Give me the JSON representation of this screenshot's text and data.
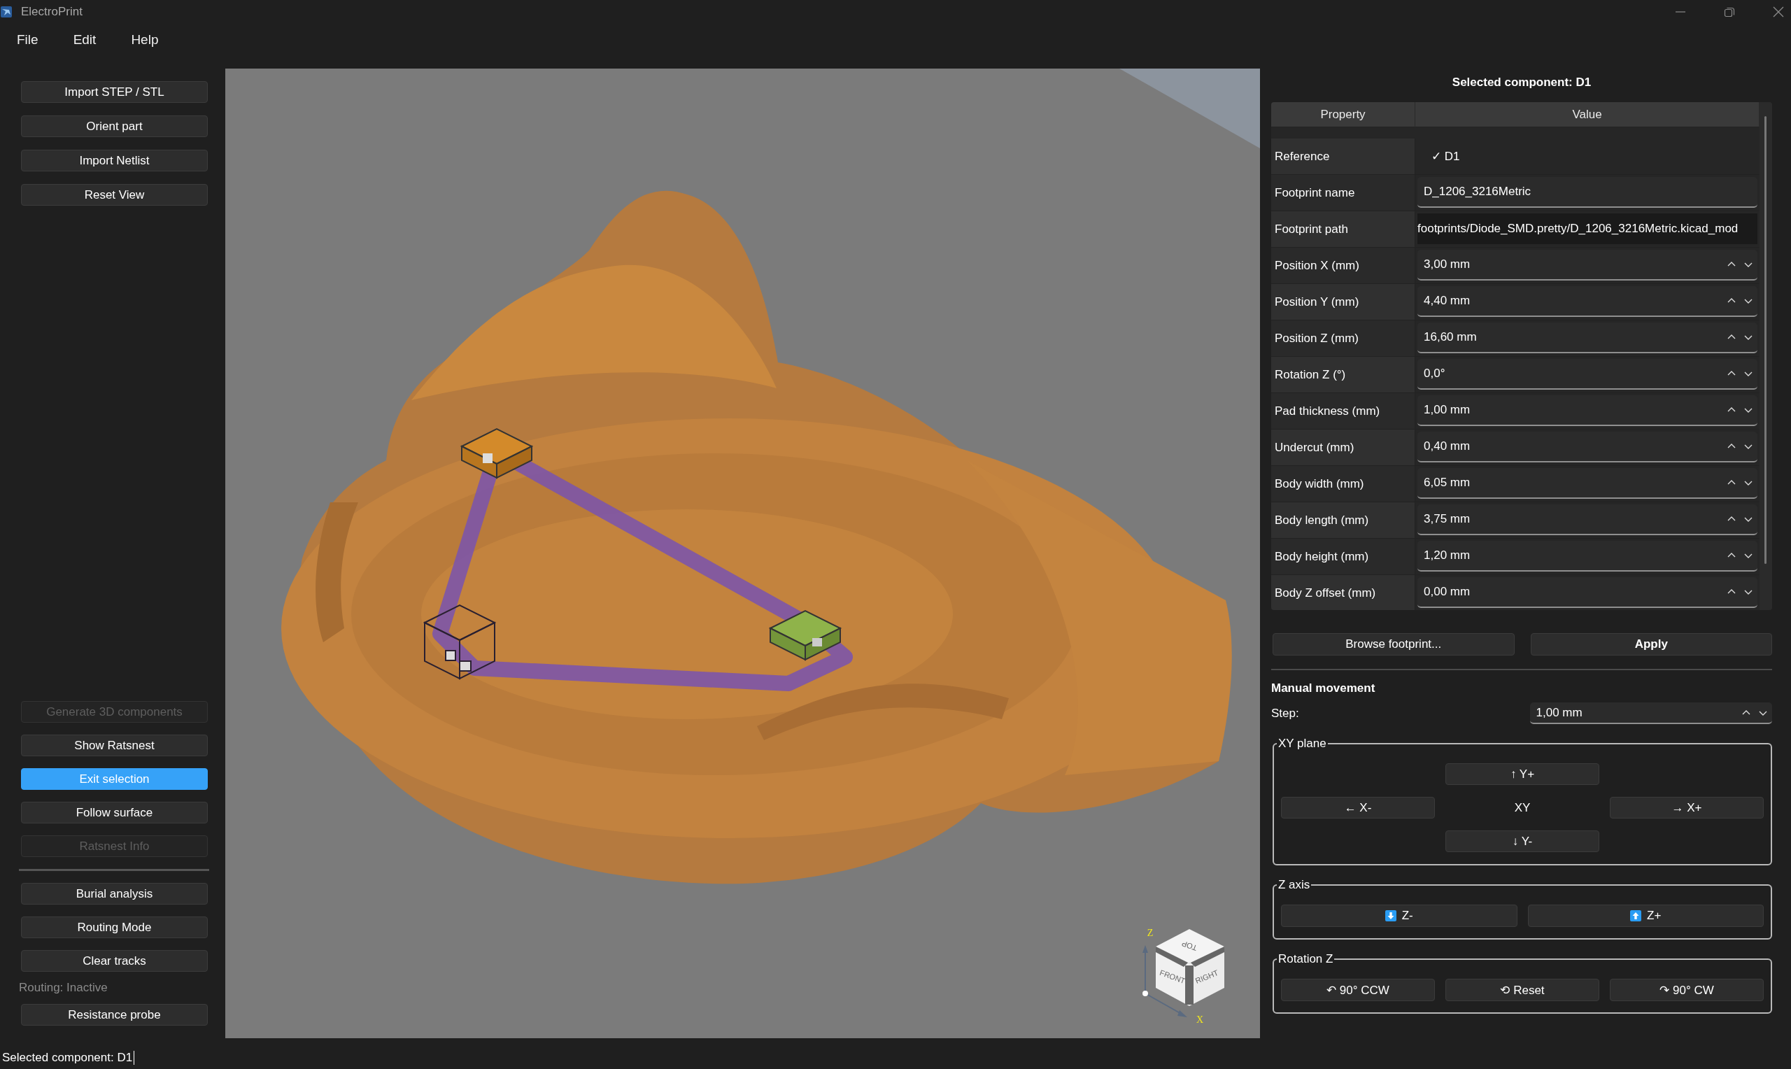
{
  "window": {
    "title": "ElectroPrint"
  },
  "menu": [
    {
      "label": "File"
    },
    {
      "label": "Edit"
    },
    {
      "label": "Help"
    }
  ],
  "sidebar": {
    "top_buttons": [
      {
        "label": "Import STEP / STL",
        "disabled": false,
        "active": false
      },
      {
        "label": "Orient part",
        "disabled": false,
        "active": false
      },
      {
        "label": "Import Netlist",
        "disabled": false,
        "active": false
      },
      {
        "label": "Reset View",
        "disabled": false,
        "active": false
      }
    ],
    "bottom_items": [
      {
        "kind": "button",
        "label": "Generate 3D components",
        "disabled": true,
        "active": false
      },
      {
        "kind": "button",
        "label": "Show Ratsnest",
        "disabled": false,
        "active": false
      },
      {
        "kind": "button",
        "label": "Exit selection",
        "disabled": false,
        "active": true
      },
      {
        "kind": "button",
        "label": "Follow surface",
        "disabled": false,
        "active": false
      },
      {
        "kind": "button",
        "label": "Ratsnest Info",
        "disabled": true,
        "active": false
      },
      {
        "kind": "separator"
      },
      {
        "kind": "button",
        "label": "Burial analysis",
        "disabled": false,
        "active": false
      },
      {
        "kind": "button",
        "label": "Routing Mode",
        "disabled": false,
        "active": false
      },
      {
        "kind": "button",
        "label": "Clear tracks",
        "disabled": false,
        "active": false
      },
      {
        "kind": "label",
        "text": "Routing: Inactive"
      },
      {
        "kind": "button",
        "label": "Resistance probe",
        "disabled": false,
        "active": false
      }
    ]
  },
  "viewport": {
    "view_cube": {
      "faces": [
        "TOP",
        "FRONT",
        "RIGHT"
      ],
      "axes": [
        "Z",
        "X"
      ]
    }
  },
  "properties": {
    "title": "Selected component: D1",
    "columns": [
      "Property",
      "Value"
    ],
    "rows": [
      {
        "kind": "plain",
        "label": "Reference",
        "value": "✓ D1"
      },
      {
        "kind": "text",
        "label": "Footprint name",
        "value": "D_1206_3216Metric"
      },
      {
        "kind": "path",
        "label": "Footprint path",
        "value": "footprints/Diode_SMD.pretty/D_1206_3216Metric.kicad_mod"
      },
      {
        "kind": "spin",
        "label": "Position X (mm)",
        "value": "3,00 mm"
      },
      {
        "kind": "spin",
        "label": "Position Y (mm)",
        "value": "4,40 mm"
      },
      {
        "kind": "spin",
        "label": "Position Z (mm)",
        "value": "16,60 mm"
      },
      {
        "kind": "spin",
        "label": "Rotation Z (°)",
        "value": "0,0°"
      },
      {
        "kind": "spin",
        "label": "Pad thickness (mm)",
        "value": "1,00 mm"
      },
      {
        "kind": "spin",
        "label": "Undercut (mm)",
        "value": "0,40 mm"
      },
      {
        "kind": "spin",
        "label": "Body width (mm)",
        "value": "6,05 mm"
      },
      {
        "kind": "spin",
        "label": "Body length (mm)",
        "value": "3,75 mm"
      },
      {
        "kind": "spin",
        "label": "Body height (mm)",
        "value": "1,20 mm"
      },
      {
        "kind": "spin",
        "label": "Body Z offset (mm)",
        "value": "0,00 mm"
      }
    ],
    "buttons": [
      {
        "label": "Browse footprint...",
        "default": false
      },
      {
        "label": "Apply",
        "default": true
      }
    ]
  },
  "manual": {
    "title": "Manual movement",
    "step": {
      "label": "Step:",
      "value": "1,00 mm"
    },
    "groups": [
      {
        "kind": "xy",
        "title": "XY plane",
        "center": "XY",
        "buttons": [
          {
            "label": "↑ Y+"
          },
          {
            "label": "← X-"
          },
          {
            "label": "→ X+"
          },
          {
            "label": "↓ Y-"
          }
        ]
      },
      {
        "kind": "zrow",
        "title": "Z axis",
        "buttons": [
          {
            "label": "Z-"
          },
          {
            "label": "Z+"
          }
        ]
      },
      {
        "kind": "row",
        "title": "Rotation Z",
        "buttons": [
          {
            "label": "↶ 90° CCW"
          },
          {
            "label": "⟲ Reset"
          },
          {
            "label": "↷ 90° CW"
          }
        ]
      }
    ]
  },
  "status_bar": {
    "text": "Selected component: D1"
  }
}
